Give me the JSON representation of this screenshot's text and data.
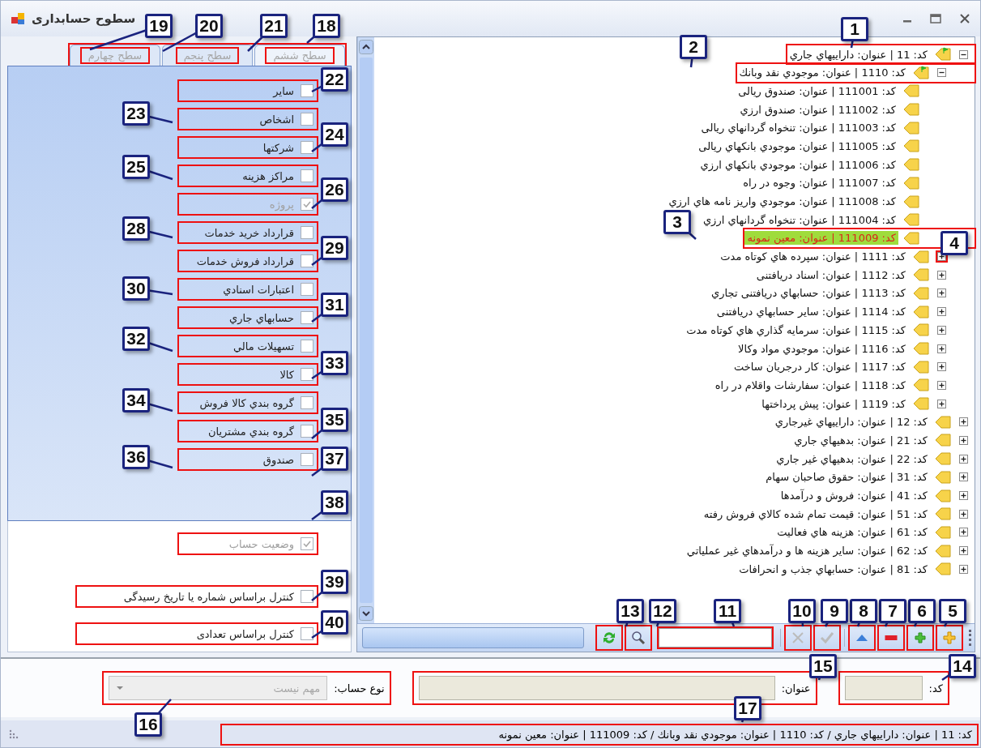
{
  "window": {
    "title": "سطوح حسابداری"
  },
  "tree": {
    "items": [
      {
        "label": "کد: 11 | عنوان: دارایيهاي جاري",
        "kind": "group",
        "expanded": true,
        "selected": false,
        "highlighted": true,
        "expander_highlighted": false,
        "children": [
          {
            "label": "کد: 1110 | عنوان: موجودي نقد وبانك",
            "kind": "group",
            "expanded": true,
            "selected": false,
            "highlighted": true,
            "expander_highlighted": false,
            "children": [
              {
                "label": "کد: 111001 | عنوان: صندوق ريالی",
                "kind": "leaf",
                "selected": false,
                "highlighted": false
              },
              {
                "label": "کد: 111002 | عنوان: صندوق ارزي",
                "kind": "leaf",
                "selected": false,
                "highlighted": false
              },
              {
                "label": "کد: 111003 | عنوان: تنخواه گردانهاي ريالی",
                "kind": "leaf",
                "selected": false,
                "highlighted": false
              },
              {
                "label": "کد: 111005 | عنوان: موجودي بانكهاي ريالی",
                "kind": "leaf",
                "selected": false,
                "highlighted": false
              },
              {
                "label": "کد: 111006 | عنوان: موجودي بانكهاي ارزي",
                "kind": "leaf",
                "selected": false,
                "highlighted": false
              },
              {
                "label": "کد: 111007 | عنوان: وجوه در راه",
                "kind": "leaf",
                "selected": false,
                "highlighted": false
              },
              {
                "label": "کد: 111008 | عنوان: موجودي واريز نامه هاي ارزي",
                "kind": "leaf",
                "selected": false,
                "highlighted": false
              },
              {
                "label": "کد: 111004 | عنوان: تنخواه گردانهاي ارزي",
                "kind": "leaf",
                "selected": false,
                "highlighted": false
              },
              {
                "label": "کد: 111009 | عنوان: معين نمونه",
                "kind": "leaf",
                "selected": true,
                "highlighted": true
              }
            ]
          },
          {
            "label": "کد: 1111 | عنوان: سپرده هاي كوتاه مدت",
            "kind": "group",
            "expanded": false,
            "selected": false,
            "highlighted": false,
            "expander_highlighted": true
          },
          {
            "label": "کد: 1112 | عنوان: اسناد دريافتنی",
            "kind": "group",
            "expanded": false,
            "selected": false,
            "highlighted": false,
            "expander_highlighted": false
          },
          {
            "label": "کد: 1113 | عنوان: حسابهاي دريافتنی تجاري",
            "kind": "group",
            "expanded": false,
            "selected": false,
            "highlighted": false,
            "expander_highlighted": false
          },
          {
            "label": "کد: 1114 | عنوان: ساير حسابهاي دريافتنی",
            "kind": "group",
            "expanded": false,
            "selected": false,
            "highlighted": false,
            "expander_highlighted": false
          },
          {
            "label": "کد: 1115 | عنوان: سرمايه گذاري هاي كوتاه مدت",
            "kind": "group",
            "expanded": false,
            "selected": false,
            "highlighted": false,
            "expander_highlighted": false
          },
          {
            "label": "کد: 1116 | عنوان: موجودي مواد وكالا",
            "kind": "group",
            "expanded": false,
            "selected": false,
            "highlighted": false,
            "expander_highlighted": false
          },
          {
            "label": "کد: 1117 | عنوان: كار درجريان ساخت",
            "kind": "group",
            "expanded": false,
            "selected": false,
            "highlighted": false,
            "expander_highlighted": false
          },
          {
            "label": "کد: 1118 | عنوان: سفارشات واقلام در راه",
            "kind": "group",
            "expanded": false,
            "selected": false,
            "highlighted": false,
            "expander_highlighted": false
          },
          {
            "label": "کد: 1119 | عنوان: پيش پرداختها",
            "kind": "group",
            "expanded": false,
            "selected": false,
            "highlighted": false,
            "expander_highlighted": false
          }
        ]
      },
      {
        "label": "کد: 12 | عنوان: دارایيهاي غيرجاري",
        "kind": "group",
        "expanded": false,
        "selected": false,
        "highlighted": false,
        "expander_highlighted": false
      },
      {
        "label": "کد: 21 | عنوان: بدهيهاي جاري",
        "kind": "group",
        "expanded": false,
        "selected": false,
        "highlighted": false,
        "expander_highlighted": false
      },
      {
        "label": "کد: 22 | عنوان: بدهيهاي غير جاري",
        "kind": "group",
        "expanded": false,
        "selected": false,
        "highlighted": false,
        "expander_highlighted": false
      },
      {
        "label": "کد: 31 | عنوان: حقوق صاحبان سهام",
        "kind": "group",
        "expanded": false,
        "selected": false,
        "highlighted": false,
        "expander_highlighted": false
      },
      {
        "label": "کد: 41 | عنوان: فروش و درآمدها",
        "kind": "group",
        "expanded": false,
        "selected": false,
        "highlighted": false,
        "expander_highlighted": false
      },
      {
        "label": "کد: 51 | عنوان: قيمت تمام شده كالاي فروش رفته",
        "kind": "group",
        "expanded": false,
        "selected": false,
        "highlighted": false,
        "expander_highlighted": false
      },
      {
        "label": "کد: 61 | عنوان: هزينه هاي فعاليت",
        "kind": "group",
        "expanded": false,
        "selected": false,
        "highlighted": false,
        "expander_highlighted": false
      },
      {
        "label": "کد: 62 | عنوان: ساير هزينه ها و درآمدهاي غير عملياتي",
        "kind": "group",
        "expanded": false,
        "selected": false,
        "highlighted": false,
        "expander_highlighted": false
      },
      {
        "label": "کد: 81 | عنوان: حسابهاي جذب و انحرافات",
        "kind": "group",
        "expanded": false,
        "selected": false,
        "highlighted": false,
        "expander_highlighted": false
      }
    ]
  },
  "toolbar": [
    {
      "kind": "add_root",
      "disabled": false,
      "highlighted": true
    },
    {
      "kind": "add_child",
      "disabled": false,
      "highlighted": true
    },
    {
      "kind": "delete",
      "disabled": false,
      "highlighted": true
    },
    {
      "kind": "move_up",
      "disabled": false,
      "highlighted": true
    },
    {
      "kind": "separator"
    },
    {
      "kind": "confirm",
      "disabled": true,
      "highlighted": true
    },
    {
      "kind": "cancel",
      "disabled": true,
      "highlighted": true
    },
    {
      "kind": "separator"
    },
    {
      "kind": "search_field",
      "highlighted": true
    },
    {
      "kind": "search",
      "disabled": false,
      "highlighted": true
    },
    {
      "kind": "refresh",
      "disabled": false,
      "highlighted": true
    }
  ],
  "tab_strip": {
    "highlighted": true,
    "tabs": [
      {
        "label": "سطح ششم",
        "selected": true,
        "disabled": true,
        "highlighted": true
      },
      {
        "label": "سطح پنجم",
        "selected": false,
        "disabled": true,
        "highlighted": true
      },
      {
        "label": "سطح چهارم",
        "selected": false,
        "disabled": true,
        "highlighted": true
      }
    ]
  },
  "detail_options": [
    {
      "label": "ساير",
      "checked": false,
      "disabled": false,
      "highlighted": true
    },
    {
      "label": "اشخاص",
      "checked": false,
      "disabled": false,
      "highlighted": true
    },
    {
      "label": "شركتها",
      "checked": false,
      "disabled": false,
      "highlighted": true
    },
    {
      "label": "مراكز هزينه",
      "checked": false,
      "disabled": false,
      "highlighted": true
    },
    {
      "label": "پروژه",
      "checked": true,
      "disabled": true,
      "highlighted": true
    },
    {
      "label": "قرارداد خريد خدمات",
      "checked": false,
      "disabled": false,
      "highlighted": true
    },
    {
      "label": "قرارداد فروش خدمات",
      "checked": false,
      "disabled": false,
      "highlighted": true
    },
    {
      "label": "اعتبارات اسنادي",
      "checked": false,
      "disabled": false,
      "highlighted": true
    },
    {
      "label": "حسابهاي جاري",
      "checked": false,
      "disabled": false,
      "highlighted": true
    },
    {
      "label": "تسهيلات مالي",
      "checked": false,
      "disabled": false,
      "highlighted": true
    },
    {
      "label": "كالا",
      "checked": false,
      "disabled": false,
      "highlighted": true
    },
    {
      "label": "گروه بندي كالا فروش",
      "checked": false,
      "disabled": false,
      "highlighted": true
    },
    {
      "label": "گروه بندي مشتريان",
      "checked": false,
      "disabled": false,
      "highlighted": true
    },
    {
      "label": "صندوق",
      "checked": false,
      "disabled": false,
      "highlighted": true
    }
  ],
  "account_status": {
    "label": "وضعيت حساب",
    "checked": true,
    "disabled": true,
    "highlighted": true
  },
  "controls": [
    {
      "label": "کنترل براساس شماره یا تاریخ رسیدگی",
      "checked": false,
      "disabled": false,
      "highlighted": true
    },
    {
      "label": "کنترل براساس تعدادی",
      "checked": false,
      "disabled": false,
      "highlighted": true
    }
  ],
  "form": {
    "code": {
      "label": "کد:",
      "highlighted": true
    },
    "title": {
      "label": "عنوان:",
      "highlighted": true
    },
    "account_type": {
      "label": "نوع حساب:",
      "value": "مهم نیست",
      "disabled": true,
      "highlighted": true
    }
  },
  "status_bar": {
    "text": "کد: 11 | عنوان: دارایيهاي جاري / کد: 1110 | عنوان: موجودي نقد وبانك / کد: 111009 | عنوان: معين نمونه",
    "highlighted": true
  },
  "callouts": [
    {
      "number": "1"
    },
    {
      "number": "2"
    },
    {
      "number": "3"
    },
    {
      "number": "4"
    },
    {
      "number": "5"
    },
    {
      "number": "6"
    },
    {
      "number": "7"
    },
    {
      "number": "8"
    },
    {
      "number": "9"
    },
    {
      "number": "10"
    },
    {
      "number": "11"
    },
    {
      "number": "12"
    },
    {
      "number": "13"
    },
    {
      "number": "14"
    },
    {
      "number": "15"
    },
    {
      "number": "16"
    },
    {
      "number": "17"
    },
    {
      "number": "18"
    },
    {
      "number": "21"
    },
    {
      "number": "20"
    },
    {
      "number": "19"
    },
    {
      "number": "22"
    },
    {
      "number": "23"
    },
    {
      "number": "24"
    },
    {
      "number": "25"
    },
    {
      "number": "26"
    },
    {
      "number": "28"
    },
    {
      "number": "29"
    },
    {
      "number": "30"
    },
    {
      "number": "31"
    },
    {
      "number": "32"
    },
    {
      "number": "33"
    },
    {
      "number": "34"
    },
    {
      "number": "35"
    },
    {
      "number": "36"
    },
    {
      "number": "37"
    },
    {
      "number": "38"
    },
    {
      "number": "39"
    },
    {
      "number": "40"
    }
  ]
}
